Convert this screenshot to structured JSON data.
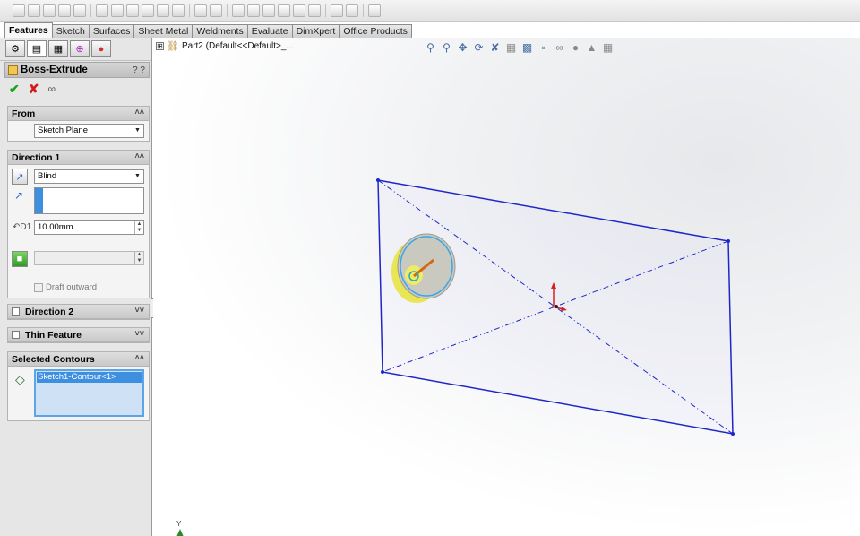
{
  "command_tabs": [
    "Features",
    "Sketch",
    "Surfaces",
    "Sheet Metal",
    "Weldments",
    "Evaluate",
    "DimXpert",
    "Office Products"
  ],
  "active_tab": "Features",
  "property_manager": {
    "title": "Boss-Extrude",
    "help": "? ?",
    "from": {
      "header": "From",
      "start_condition": "Sketch Plane"
    },
    "direction1": {
      "header": "Direction 1",
      "end_condition": "Blind",
      "depth": "10.00mm",
      "draft_label": "Draft outward"
    },
    "direction2": {
      "header": "Direction 2"
    },
    "thin_feature": {
      "header": "Thin Feature"
    },
    "selected_contours": {
      "header": "Selected Contours",
      "items": [
        "Sketch1-Contour<1>"
      ]
    }
  },
  "feature_tree": {
    "expander": "⊞",
    "label": "Part2  (Default<<Default>_..."
  },
  "triad_label": "Y",
  "colors": {
    "sketch_line": "#1f26c8",
    "extrude_preview": "#e8e43a",
    "accent": "#3f8fe0"
  }
}
